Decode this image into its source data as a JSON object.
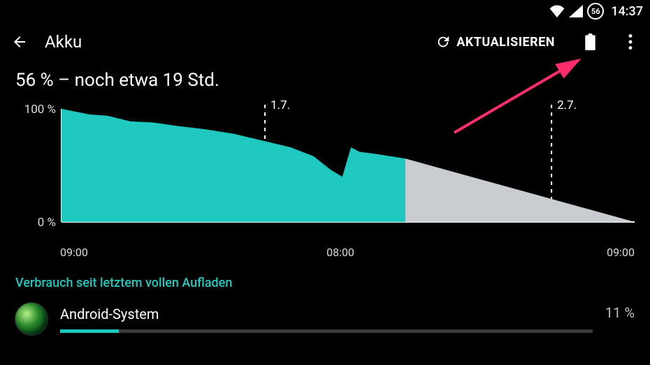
{
  "status": {
    "battery_pct": "56",
    "clock": "14:37"
  },
  "appbar": {
    "title": "Akku",
    "refresh_label": "AKTUALISIEREN"
  },
  "summary": {
    "text": "56 % – noch etwa 19 Std."
  },
  "section": {
    "usage_title": "Verbrauch seit letztem vollen Aufladen"
  },
  "usage": [
    {
      "name": "Android-System",
      "percent_label": "11 %",
      "bar_pct": 11
    }
  ],
  "chart_data": {
    "type": "area",
    "title": "",
    "ylabel": "",
    "xlabel": "",
    "ylim": [
      0,
      100
    ],
    "y_ticks": [
      "100 %",
      "0 %"
    ],
    "x_ticks": [
      "09:00",
      "08:00",
      "09:00"
    ],
    "date_markers": [
      {
        "label": "1.7.",
        "x_frac": 0.355
      },
      {
        "label": "2.7.",
        "x_frac": 0.855
      }
    ],
    "projection_start_frac": 0.6,
    "series": [
      {
        "name": "battery_history",
        "color": "#1fc9c0",
        "points": [
          {
            "x_frac": 0.0,
            "pct": 100
          },
          {
            "x_frac": 0.02,
            "pct": 98
          },
          {
            "x_frac": 0.05,
            "pct": 95
          },
          {
            "x_frac": 0.08,
            "pct": 94
          },
          {
            "x_frac": 0.12,
            "pct": 89
          },
          {
            "x_frac": 0.16,
            "pct": 88
          },
          {
            "x_frac": 0.2,
            "pct": 85
          },
          {
            "x_frac": 0.25,
            "pct": 82
          },
          {
            "x_frac": 0.3,
            "pct": 78
          },
          {
            "x_frac": 0.35,
            "pct": 72
          },
          {
            "x_frac": 0.4,
            "pct": 66
          },
          {
            "x_frac": 0.44,
            "pct": 58
          },
          {
            "x_frac": 0.47,
            "pct": 46
          },
          {
            "x_frac": 0.49,
            "pct": 40
          },
          {
            "x_frac": 0.505,
            "pct": 66
          },
          {
            "x_frac": 0.52,
            "pct": 62
          },
          {
            "x_frac": 0.55,
            "pct": 60
          },
          {
            "x_frac": 0.6,
            "pct": 56
          }
        ]
      },
      {
        "name": "battery_projection",
        "color": "#c9ccd0",
        "points": [
          {
            "x_frac": 0.6,
            "pct": 56
          },
          {
            "x_frac": 1.0,
            "pct": 0
          }
        ]
      }
    ]
  }
}
